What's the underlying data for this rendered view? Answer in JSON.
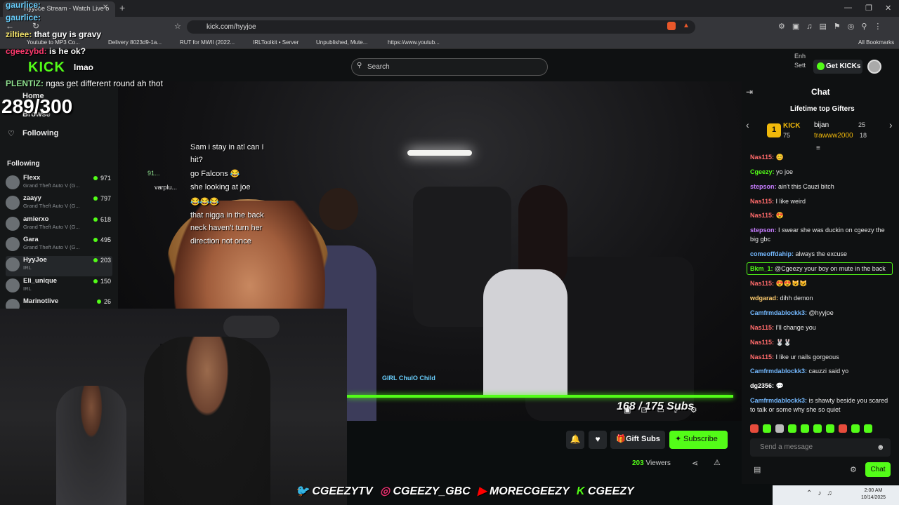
{
  "browser": {
    "tab_title": "HyyJoe Stream - Watch Live o",
    "url": "kick.com/hyyjoe",
    "bookmarks": [
      "Youtube to MP3 Co...",
      "Delivery 8023d9-1a...",
      "RUT for MWII (2022...",
      "IRLToolkit • Server",
      "Unpublished, Mute...",
      "https://www.youtub..."
    ],
    "all_bookmarks": "All Bookmarks"
  },
  "header": {
    "search_placeholder": "Search",
    "get_kicks": "Get KICKs",
    "enh_label": "Enh",
    "sett_label": "Sett"
  },
  "stream_overlay": {
    "goal": "289/300",
    "chat": [
      {
        "user": "gaurlice:",
        "text": ""
      },
      {
        "user": "gaurlice:",
        "text": ""
      },
      {
        "user": "ziltiee:",
        "text": "that guy is gravy"
      },
      {
        "user": "cgeezybd:",
        "text": "is he ok?"
      },
      {
        "user": "",
        "text": "lmao"
      },
      {
        "user": "PLENTIZ:",
        "text": "ngas get different round ah thot"
      }
    ]
  },
  "sidebar": {
    "nav": [
      "Home",
      "Browse",
      "Following"
    ],
    "following_heading": "Following",
    "channels": [
      {
        "name": "Flexx",
        "category": "Grand Theft Auto V (G...",
        "viewers": "971"
      },
      {
        "name": "zaayy",
        "category": "Grand Theft Auto V (G...",
        "viewers": "797"
      },
      {
        "name": "amierxo",
        "category": "Grand Theft Auto V (G...",
        "viewers": "618"
      },
      {
        "name": "Gara",
        "category": "Grand Theft Auto V (G...",
        "viewers": "495"
      },
      {
        "name": "HyyJoe",
        "category": "IRL",
        "viewers": "203"
      },
      {
        "name": "Eli_unique",
        "category": "IRL",
        "viewers": "150"
      },
      {
        "name": "Marinotlive",
        "category": "IRL",
        "viewers": "26"
      }
    ]
  },
  "video": {
    "overlay_chat": [
      "Sam i stay in atl can I",
      "hit?",
      "go Falcons 😂",
      "she looking at joe",
      "😂😂😂",
      "that nigga in the back",
      "neck haven't turn her",
      "direction not once"
    ],
    "overlay_users": [
      "91...",
      "varplu..."
    ],
    "sub_goal": "168 / 175 Subs",
    "sponsor_text": "GIRL  ChulO  Child"
  },
  "webcam": {
    "socials": [
      "CGEEZYTV",
      "CGEEZY_GBC",
      "MORECGEEZY",
      "CGEEZY"
    ]
  },
  "actions": {
    "gift_subs": "Gift Subs",
    "subscribe": "Subscribe",
    "viewer_count": "203",
    "viewers_label": "Viewers"
  },
  "chat": {
    "title": "Chat",
    "gifters_title": "Lifetime top Gifters",
    "gifters": [
      {
        "rank": "1",
        "name": "KICK",
        "count": "75"
      },
      {
        "name": "bijan",
        "count": "25"
      },
      {
        "name": "trawww2000",
        "count": "18"
      }
    ],
    "messages": [
      {
        "user": "Nas115:",
        "text": "😊",
        "color": "#ff6b6b"
      },
      {
        "user": "Cgeezy:",
        "text": "yo joe",
        "color": "#53fc18"
      },
      {
        "user": "stepson:",
        "text": "ain't this Cauzi bitch",
        "color": "#c77dff"
      },
      {
        "user": "Nas115:",
        "text": "I like weird",
        "color": "#ff6b6b"
      },
      {
        "user": "Nas115:",
        "text": "😍",
        "color": "#ff6b6b"
      },
      {
        "user": "stepson:",
        "text": "I swear she was duckin on cgeezy the big gbc",
        "color": "#c77dff"
      },
      {
        "user": "comeoffdahip:",
        "text": "always the excuse",
        "color": "#74b9ff"
      },
      {
        "user": "Bkm_1:",
        "text": "@Cgeezy your boy on mute in the back",
        "color": "#53fc18"
      },
      {
        "user": "Nas115:",
        "text": "😍😍😺😺",
        "color": "#ff6b6b"
      },
      {
        "user": "wdgarad:",
        "text": "dihh demon",
        "color": "#fdcb6e"
      },
      {
        "user": "Camfrmdablockk3:",
        "text": "@hyyjoe",
        "color": "#74b9ff"
      },
      {
        "user": "Nas115:",
        "text": "I'll change you",
        "color": "#ff6b6b"
      },
      {
        "user": "Nas115:",
        "text": "🐰🐰",
        "color": "#ff6b6b"
      },
      {
        "user": "Nas115:",
        "text": "I like ur nails gorgeous",
        "color": "#ff6b6b"
      },
      {
        "user": "Camfrmdablockk3:",
        "text": "cauzzi said yo",
        "color": "#74b9ff"
      },
      {
        "user": "dg2356:",
        "text": "💬",
        "color": "#ffffff"
      },
      {
        "user": "Camfrmdablockk3:",
        "text": "is shawty beside you scared to talk or some why she so quiet",
        "color": "#74b9ff"
      }
    ],
    "send_placeholder": "Send a message",
    "chat_button": "Chat"
  },
  "system": {
    "time": "2:00 AM",
    "date": "10/14/2025"
  },
  "colors": {
    "accent": "#53fc18",
    "background": "#0b0e0f"
  }
}
